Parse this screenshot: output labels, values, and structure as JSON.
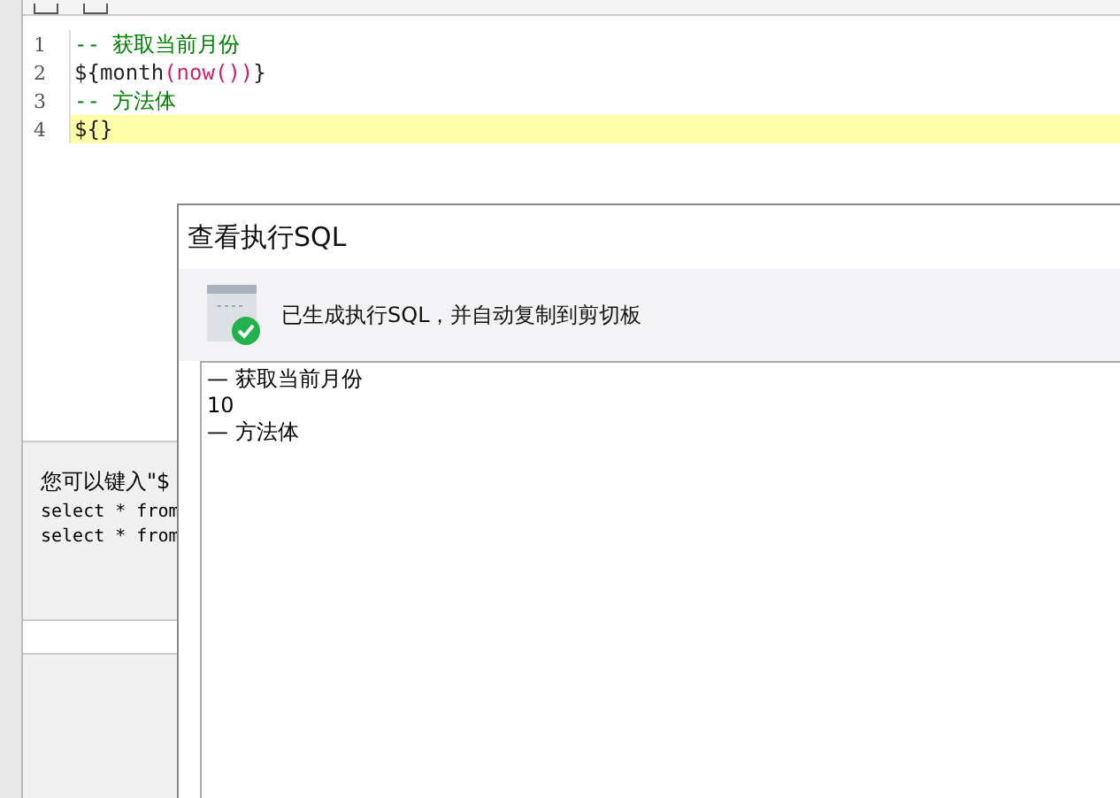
{
  "editor": {
    "lines": [
      {
        "number": "1",
        "highlighted": false,
        "tokens": [
          {
            "kind": "comment",
            "text": "-- 获取当前月份"
          }
        ]
      },
      {
        "number": "2",
        "highlighted": false,
        "tokens": [
          {
            "kind": "plain",
            "text": "${month"
          },
          {
            "kind": "paren",
            "text": "(now())"
          },
          {
            "kind": "plain",
            "text": "}"
          }
        ]
      },
      {
        "number": "3",
        "highlighted": false,
        "tokens": [
          {
            "kind": "comment",
            "text": "-- 方法体"
          }
        ]
      },
      {
        "number": "4",
        "highlighted": true,
        "tokens": [
          {
            "kind": "plain",
            "text": "${}"
          }
        ]
      }
    ]
  },
  "hint_panel": {
    "lines": [
      {
        "kind": "prose",
        "text": "您可以键入\"$"
      },
      {
        "kind": "code",
        "text": "select * from"
      },
      {
        "kind": "code",
        "text": "select * from"
      }
    ]
  },
  "dialog": {
    "title": "查看执行SQL",
    "message": "已生成执行SQL，并自动复制到剪切板",
    "output": [
      "— 获取当前月份",
      "10",
      "— 方法体"
    ]
  }
}
